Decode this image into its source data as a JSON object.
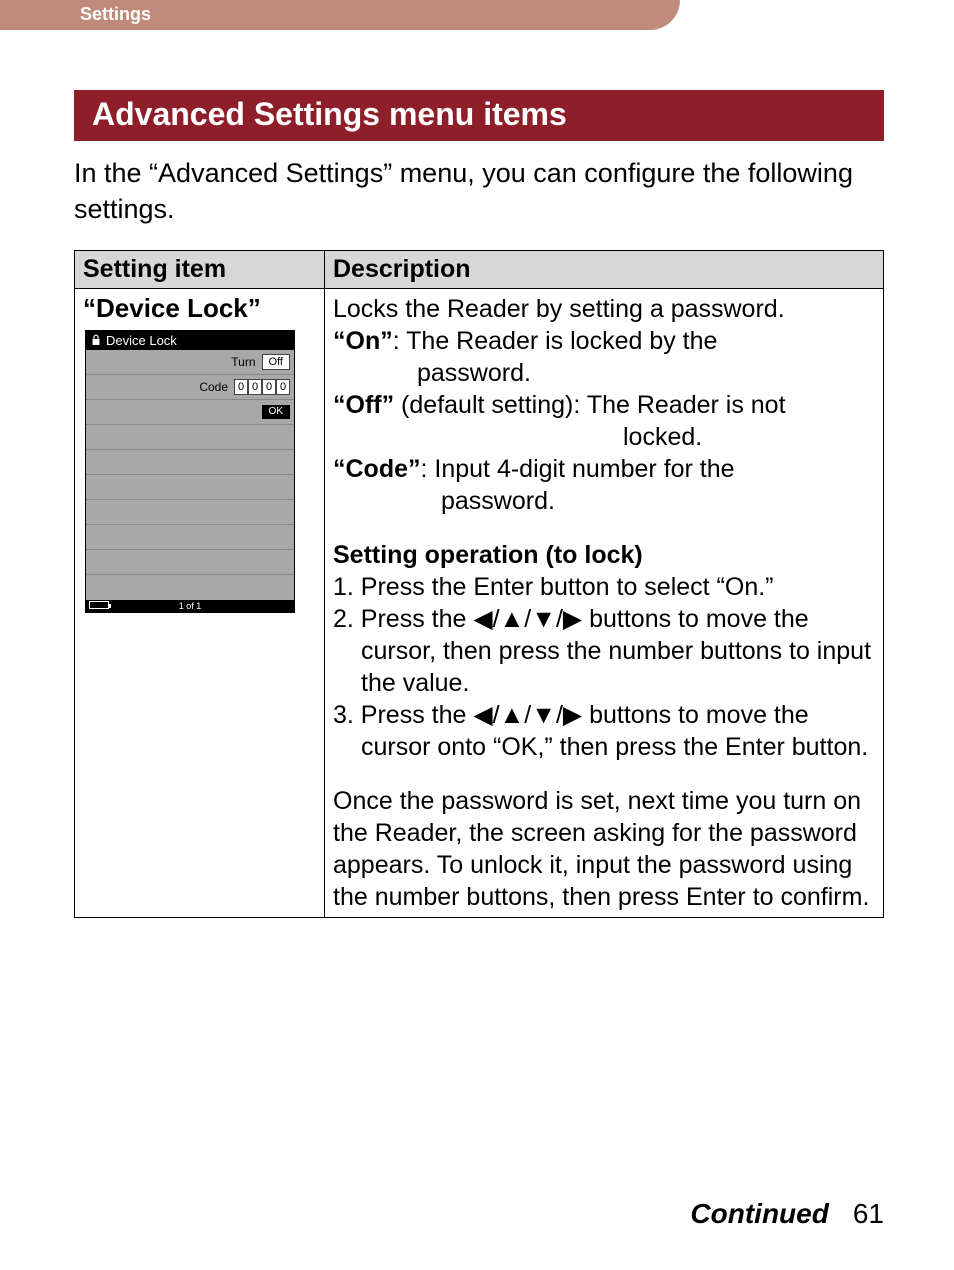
{
  "header": {
    "tab_label": "Settings"
  },
  "section": {
    "title": "Advanced Settings menu items",
    "intro": "In the “Advanced Settings” menu, you can configure the following settings."
  },
  "table": {
    "col1": "Setting item",
    "col2": "Description",
    "row1": {
      "name": "“Device Lock”",
      "device": {
        "title": "Device Lock",
        "turn_label": "Turn",
        "turn_value": "Off",
        "code_label": "Code",
        "code_digits": [
          "0",
          "0",
          "0",
          "0"
        ],
        "ok": "OK",
        "footer": "1 of 1"
      },
      "desc": {
        "line1": "Locks the Reader by setting a password.",
        "on_label": "“On”",
        "on_text": ": The Reader is locked by the",
        "on_cont": "password.",
        "off_label": "“Off”",
        "off_text": " (default setting): The Reader is not",
        "off_cont": "locked.",
        "code_label": "“Code”",
        "code_text": ": Input 4-digit number for the",
        "code_cont": "password.",
        "op_heading": "Setting operation (to lock)",
        "step1": "1. Press the Enter button to select “On.”",
        "step2a": "2. Press the ",
        "step2b": " buttons to move the cursor, then press the number buttons to input the value.",
        "step3a": "3. Press the ",
        "step3b": " buttons to move the cursor onto “OK,” then press the Enter button.",
        "after": "Once the password is set, next time you turn on the Reader, the screen asking for the password appears. To unlock it, input the password using the number buttons, then press Enter to confirm."
      }
    }
  },
  "footer": {
    "continued": "Continued",
    "page": "61"
  },
  "glyphs": {
    "arrows": "◀/▲/▼/▶"
  }
}
